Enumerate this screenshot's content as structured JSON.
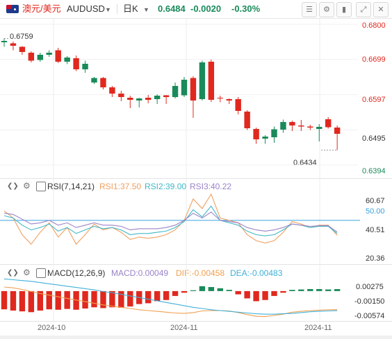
{
  "header": {
    "pair_cn": "澳元/美元",
    "symbol": "AUDUSD",
    "interval": "日K",
    "price": "0.6484",
    "change": "-0.0020",
    "change_pct": "-0.30%"
  },
  "colors": {
    "up": "#1a8a5a",
    "down": "#e0281e",
    "rsi1": "#f0a060",
    "rsi2": "#40b8c8",
    "rsi3": "#9a82c8",
    "dif": "#f0a050",
    "dea": "#40b0d8",
    "price_axis_text": "#e0281e",
    "rsi_50_line": "#3aa0e0"
  },
  "chart_data": [
    {
      "type": "candlestick",
      "name": "AUDUSD daily",
      "y_ticks": [
        "0.6800",
        "0.6699",
        "0.6597",
        "0.6495",
        "0.6394"
      ],
      "ylim": [
        0.637,
        0.681
      ],
      "annotations": {
        "high_label": "0.6759",
        "low_label": "0.6434"
      },
      "x_ticks": [
        "2024-10",
        "2024-11",
        "2024-11"
      ],
      "candles": [
        {
          "o": 0.6748,
          "h": 0.6759,
          "l": 0.6735,
          "c": 0.6752
        },
        {
          "o": 0.6745,
          "h": 0.675,
          "l": 0.6725,
          "c": 0.6738
        },
        {
          "o": 0.6735,
          "h": 0.6737,
          "l": 0.6712,
          "c": 0.672
        },
        {
          "o": 0.6718,
          "h": 0.6722,
          "l": 0.669,
          "c": 0.6695
        },
        {
          "o": 0.6697,
          "h": 0.6718,
          "l": 0.6692,
          "c": 0.6712
        },
        {
          "o": 0.6712,
          "h": 0.6725,
          "l": 0.6706,
          "c": 0.6718
        },
        {
          "o": 0.6725,
          "h": 0.6732,
          "l": 0.6688,
          "c": 0.6692
        },
        {
          "o": 0.6692,
          "h": 0.6708,
          "l": 0.6685,
          "c": 0.6704
        },
        {
          "o": 0.6702,
          "h": 0.671,
          "l": 0.6665,
          "c": 0.667
        },
        {
          "o": 0.667,
          "h": 0.6695,
          "l": 0.666,
          "c": 0.6686
        },
        {
          "o": 0.6632,
          "h": 0.6648,
          "l": 0.6628,
          "c": 0.6645
        },
        {
          "o": 0.6645,
          "h": 0.6648,
          "l": 0.6612,
          "c": 0.6618
        },
        {
          "o": 0.6618,
          "h": 0.6622,
          "l": 0.659,
          "c": 0.66
        },
        {
          "o": 0.66,
          "h": 0.6608,
          "l": 0.6578,
          "c": 0.659
        },
        {
          "o": 0.6588,
          "h": 0.6594,
          "l": 0.6558,
          "c": 0.6582
        },
        {
          "o": 0.658,
          "h": 0.6588,
          "l": 0.656,
          "c": 0.6586
        },
        {
          "o": 0.6588,
          "h": 0.6596,
          "l": 0.6572,
          "c": 0.6582
        },
        {
          "o": 0.6584,
          "h": 0.6598,
          "l": 0.657,
          "c": 0.6594
        },
        {
          "o": 0.6595,
          "h": 0.6596,
          "l": 0.657,
          "c": 0.659
        },
        {
          "o": 0.659,
          "h": 0.6632,
          "l": 0.6586,
          "c": 0.6622
        },
        {
          "o": 0.6595,
          "h": 0.6648,
          "l": 0.659,
          "c": 0.664
        },
        {
          "o": 0.6645,
          "h": 0.665,
          "l": 0.653,
          "c": 0.658
        },
        {
          "o": 0.6584,
          "h": 0.6695,
          "l": 0.658,
          "c": 0.669
        },
        {
          "o": 0.6692,
          "h": 0.6698,
          "l": 0.6576,
          "c": 0.6582
        },
        {
          "o": 0.6588,
          "h": 0.6594,
          "l": 0.6575,
          "c": 0.6586
        },
        {
          "o": 0.6584,
          "h": 0.6586,
          "l": 0.657,
          "c": 0.658
        },
        {
          "o": 0.6584,
          "h": 0.659,
          "l": 0.654,
          "c": 0.655
        },
        {
          "o": 0.6548,
          "h": 0.6552,
          "l": 0.6495,
          "c": 0.65
        },
        {
          "o": 0.6498,
          "h": 0.6502,
          "l": 0.6455,
          "c": 0.6468
        },
        {
          "o": 0.647,
          "h": 0.648,
          "l": 0.6455,
          "c": 0.6476
        },
        {
          "o": 0.6474,
          "h": 0.6505,
          "l": 0.6458,
          "c": 0.6497
        },
        {
          "o": 0.6496,
          "h": 0.6525,
          "l": 0.6487,
          "c": 0.6518
        },
        {
          "o": 0.6518,
          "h": 0.6522,
          "l": 0.6492,
          "c": 0.6508
        },
        {
          "o": 0.6508,
          "h": 0.6524,
          "l": 0.6492,
          "c": 0.6505
        },
        {
          "o": 0.6505,
          "h": 0.651,
          "l": 0.6495,
          "c": 0.6502
        },
        {
          "o": 0.6498,
          "h": 0.6512,
          "l": 0.6462,
          "c": 0.6504
        },
        {
          "o": 0.6526,
          "h": 0.6532,
          "l": 0.6499,
          "c": 0.6503
        },
        {
          "o": 0.6502,
          "h": 0.6508,
          "l": 0.6437,
          "c": 0.6484
        }
      ]
    },
    {
      "type": "line",
      "name": "RSI",
      "label": "RSI(7,14,21)",
      "y_ticks": [
        "60.67",
        "50.00",
        "40.51",
        "20.36"
      ],
      "ylim": [
        15,
        75
      ],
      "series": [
        {
          "name": "RSI1",
          "label": "RSI1:37.50",
          "values": [
            58,
            52,
            38,
            30,
            40,
            48,
            36,
            44,
            30,
            38,
            47,
            42,
            44,
            40,
            34,
            36,
            35,
            36,
            38,
            42,
            50,
            68,
            60,
            72,
            52,
            50,
            48,
            38,
            33,
            31,
            33,
            40,
            49,
            47,
            44,
            46,
            46,
            37.5
          ]
        },
        {
          "name": "RSI2",
          "label": "RSI2:39.00",
          "values": [
            54,
            52,
            46,
            42,
            44,
            47,
            41,
            44,
            39,
            42,
            45,
            43,
            44,
            42,
            38,
            39,
            39,
            40,
            41,
            44,
            49,
            59,
            53,
            62,
            50,
            48,
            46,
            41,
            38,
            37,
            38,
            42,
            47,
            46,
            44,
            45,
            45,
            39
          ]
        },
        {
          "name": "RSI3",
          "label": "RSI3:40.22",
          "values": [
            56,
            55,
            51,
            47,
            48,
            50,
            46,
            48,
            44,
            46,
            48,
            46,
            46,
            45,
            42,
            43,
            43,
            43,
            44,
            46,
            50,
            56,
            52,
            57,
            50,
            49,
            48,
            44,
            42,
            41,
            42,
            44,
            47,
            46,
            45,
            45.5,
            45.5,
            40.22
          ]
        }
      ]
    },
    {
      "type": "bar+line",
      "name": "MACD",
      "label": "MACD(12,26,9)",
      "y_ticks": [
        "0.00275",
        "-0.00150",
        "-0.00574"
      ],
      "ylim": [
        -0.0072,
        0.0034
      ],
      "labels": {
        "macd": "MACD:0.00049",
        "dif": "DIF:-0.00458",
        "dea": "DEA:-0.00483"
      },
      "hist": [
        -0.0045,
        -0.0048,
        -0.005,
        -0.0052,
        -0.0048,
        -0.0045,
        -0.0046,
        -0.0044,
        -0.0046,
        -0.0043,
        -0.004,
        -0.0042,
        -0.004,
        -0.0041,
        -0.0038,
        -0.0032,
        -0.003,
        -0.0025,
        -0.0022,
        -0.0012,
        -0.0004,
        0.0002,
        0.0012,
        0.001,
        0.0007,
        0.0003,
        -0.0008,
        -0.0018,
        -0.0025,
        -0.0022,
        -0.0012,
        -0.0004,
        0.0003,
        0.0004,
        0.0005,
        0.0005,
        0.0004,
        0.00049
      ],
      "dif": [
        0.001,
        0.0008,
        0.0004,
        -0.0001,
        -0.0006,
        -0.001,
        -0.0014,
        -0.0018,
        -0.0022,
        -0.0026,
        -0.003,
        -0.0034,
        -0.0037,
        -0.004,
        -0.0043,
        -0.0046,
        -0.0048,
        -0.005,
        -0.0052,
        -0.0054,
        -0.0055,
        -0.0053,
        -0.0049,
        -0.0048,
        -0.0048,
        -0.0049,
        -0.0053,
        -0.0058,
        -0.0062,
        -0.0063,
        -0.006,
        -0.0057,
        -0.0052,
        -0.005,
        -0.0048,
        -0.0047,
        -0.0046,
        -0.00458
      ],
      "dea": [
        0.003,
        0.0028,
        0.0026,
        0.0024,
        0.0021,
        0.0018,
        0.0015,
        0.0012,
        0.0009,
        0.0006,
        0.0003,
        -0.0001,
        -0.0004,
        -0.0008,
        -0.0012,
        -0.0016,
        -0.002,
        -0.0024,
        -0.0028,
        -0.0032,
        -0.0036,
        -0.004,
        -0.0043,
        -0.0046,
        -0.0048,
        -0.005,
        -0.0052,
        -0.0054,
        -0.0056,
        -0.0057,
        -0.0057,
        -0.0056,
        -0.0055,
        -0.0053,
        -0.0051,
        -0.005,
        -0.0049,
        -0.00483
      ]
    }
  ]
}
